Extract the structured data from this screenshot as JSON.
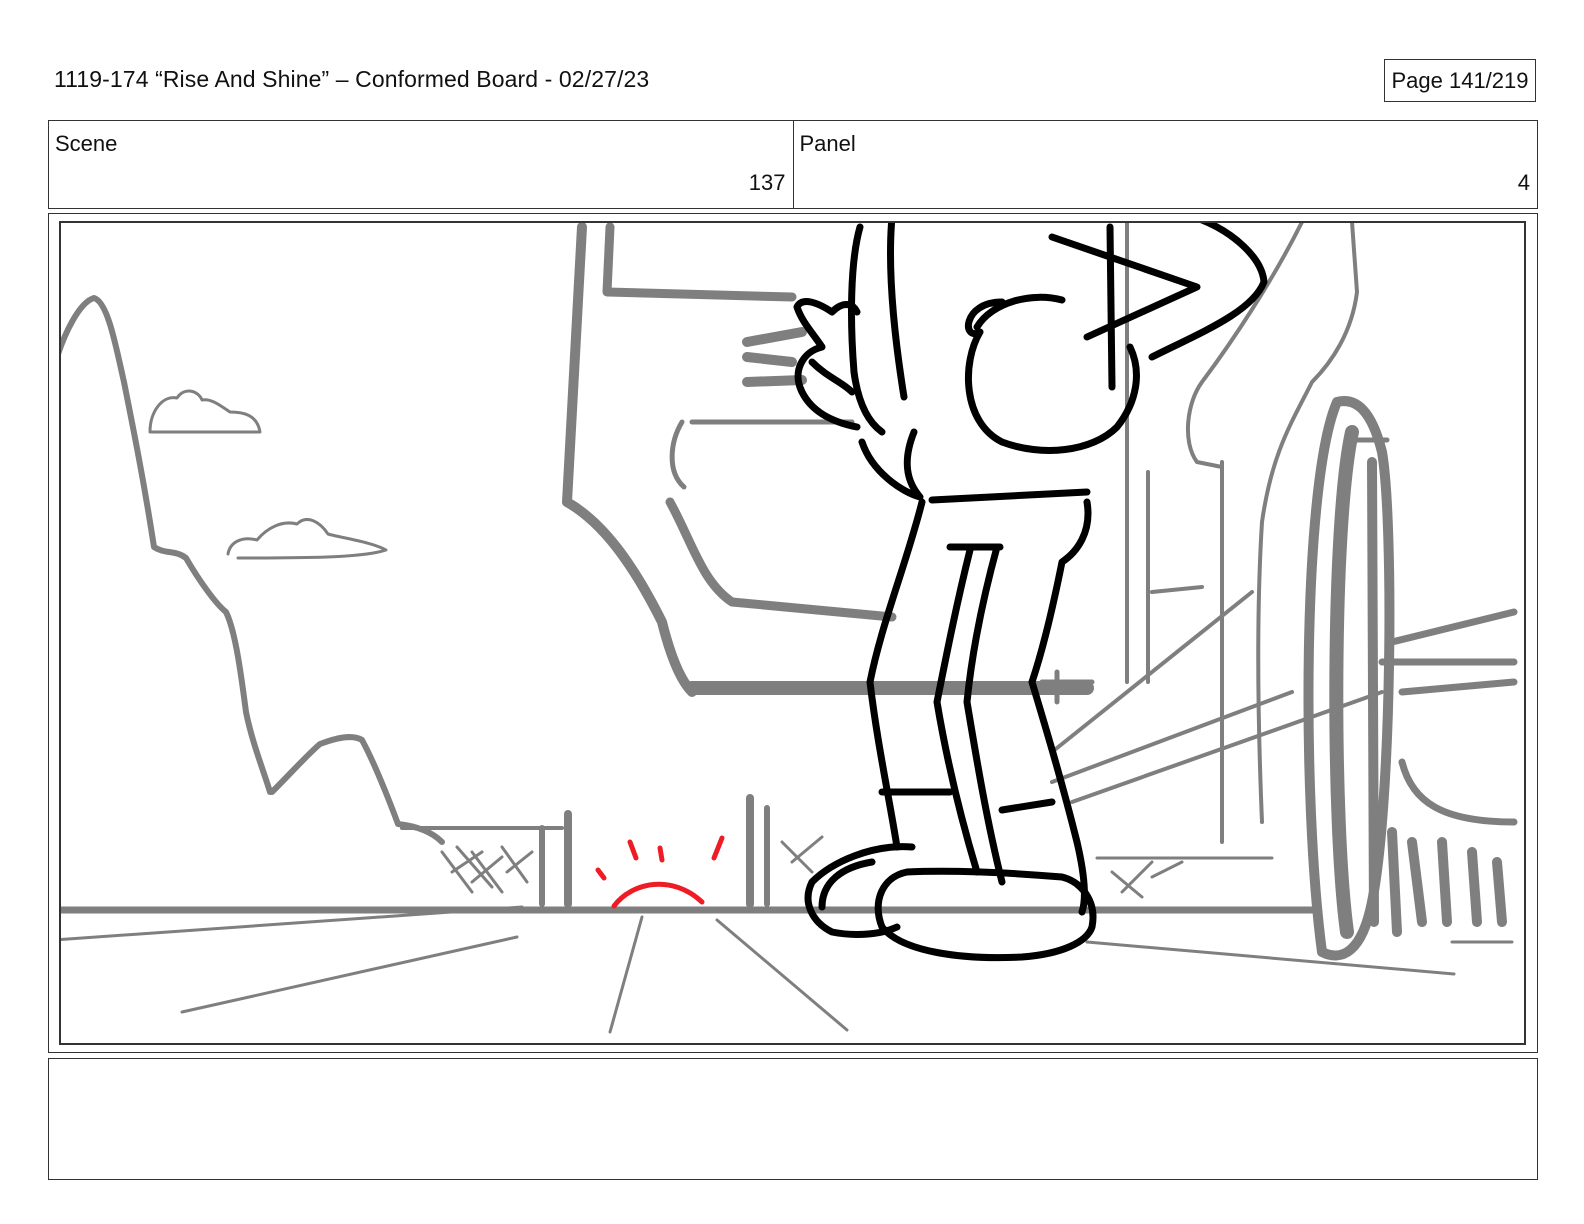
{
  "header": {
    "title": "1119-174 “Rise And Shine” – Conformed Board - 02/27/23",
    "page": "Page 141/219"
  },
  "info": {
    "scene_label": "Scene",
    "scene_value": "137",
    "panel_label": "Panel",
    "panel_value": "4"
  },
  "notes": {
    "text": ""
  },
  "colors": {
    "background_lines": "#7f7f7f",
    "character_lines": "#000000",
    "highlight": "#ee1c24"
  }
}
